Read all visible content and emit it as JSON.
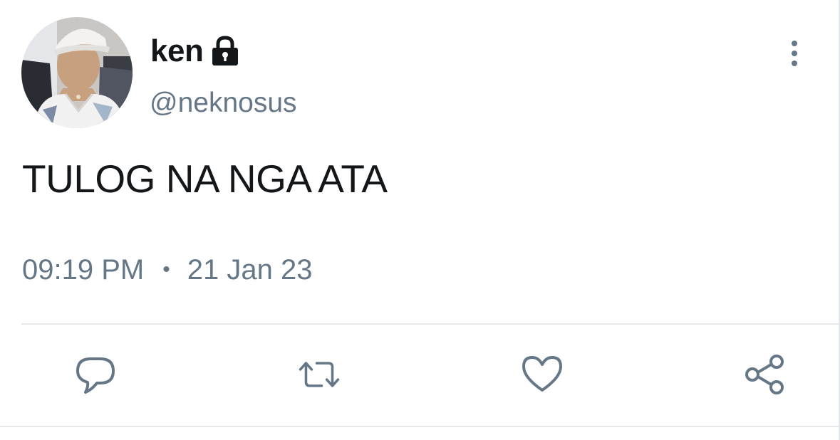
{
  "tweet": {
    "author": {
      "display_name": "ken",
      "handle": "@neknosus",
      "protected_icon": "lock-icon",
      "avatar_icon": "profile-photo"
    },
    "text": "TULOG NA NGA ATA",
    "time": "09:19 PM",
    "separator": "•",
    "date": "21 Jan 23"
  },
  "actions": [
    {
      "name": "reply",
      "icon": "speech-bubble-icon"
    },
    {
      "name": "retweet",
      "icon": "retweet-arrows-icon"
    },
    {
      "name": "like",
      "icon": "heart-icon"
    },
    {
      "name": "share",
      "icon": "share-nodes-icon"
    }
  ],
  "menu": {
    "icon": "vertical-ellipsis-icon"
  },
  "colors": {
    "text_primary": "#14171a",
    "text_secondary": "#657786",
    "divider": "#e6e9ec",
    "background": "#ffffff"
  }
}
